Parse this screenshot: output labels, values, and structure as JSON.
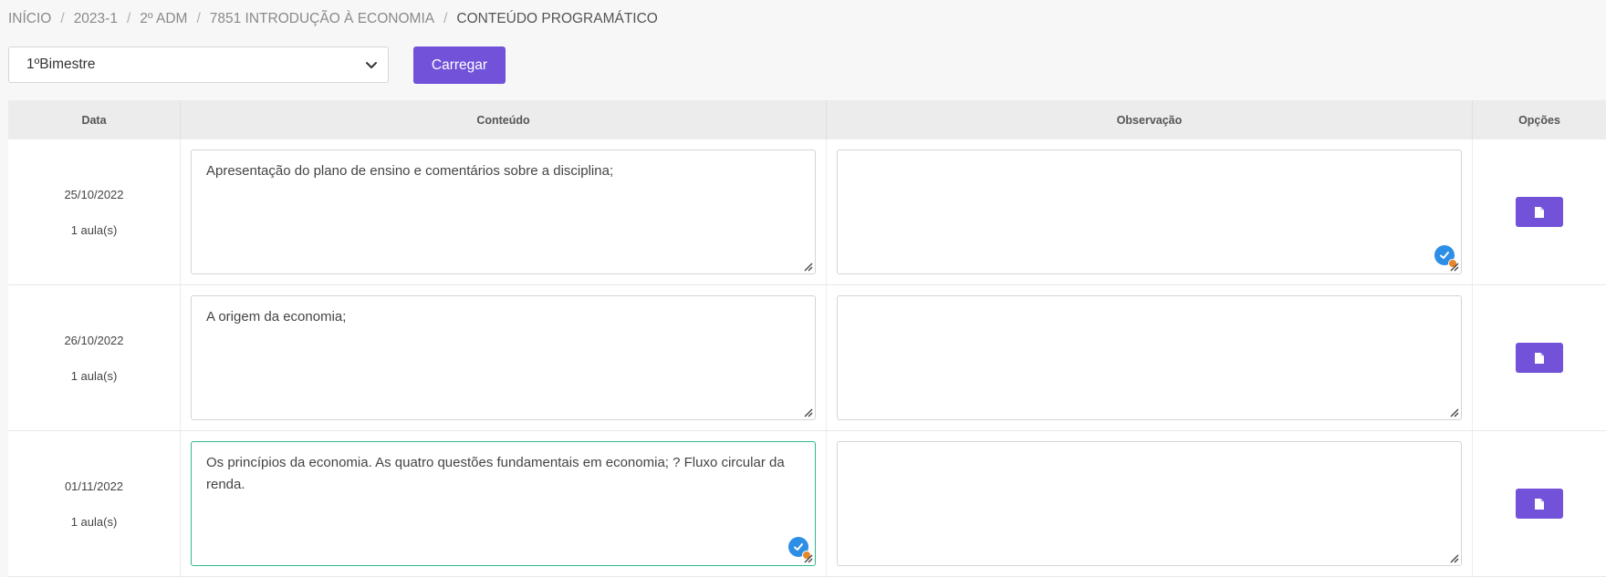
{
  "breadcrumb": [
    {
      "label": "INÍCIO"
    },
    {
      "label": "2023-1"
    },
    {
      "label": "2º ADM"
    },
    {
      "label": "7851 INTRODUÇÃO À ECONOMIA"
    },
    {
      "label": "CONTEÚDO PROGRAMÁTICO"
    }
  ],
  "filter": {
    "selected": "1ºBimestre",
    "load_label": "Carregar"
  },
  "table": {
    "headers": {
      "date": "Data",
      "content": "Conteúdo",
      "observation": "Observação",
      "options": "Opções"
    },
    "rows": [
      {
        "date": "25/10/2022",
        "aulas": "1 aula(s)",
        "content": "Apresentação do plano de ensino e comentários sobre a disciplina;",
        "observation": ""
      },
      {
        "date": "26/10/2022",
        "aulas": "1 aula(s)",
        "content": "A origem da economia;",
        "observation": ""
      },
      {
        "date": "01/11/2022",
        "aulas": "1 aula(s)",
        "content": "Os princípios da economia. As quatro questões fundamentais em economia; ? Fluxo circular da renda.",
        "observation": ""
      }
    ]
  },
  "colors": {
    "accent": "#7152d9",
    "focus_border": "#2fb98f",
    "check_badge": "#2d8ee6"
  }
}
